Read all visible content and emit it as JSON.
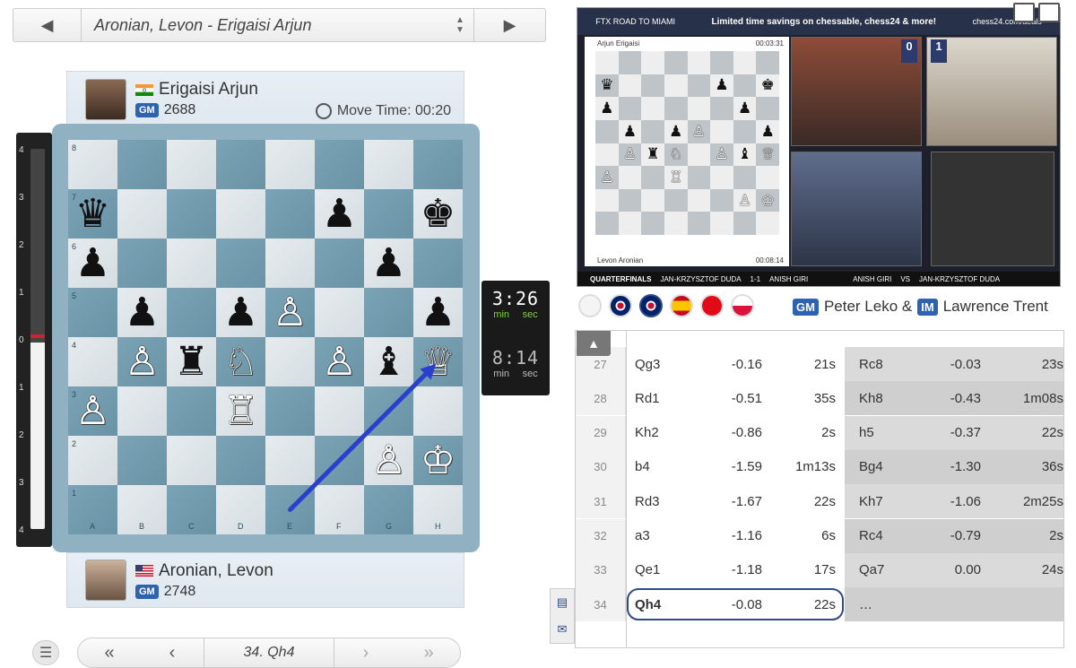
{
  "game_selector": {
    "title": "Aronian, Levon - Erigaisi Arjun",
    "prev_icon": "triangle-left",
    "next_icon": "triangle-right"
  },
  "top_player": {
    "name": "Erigaisi Arjun",
    "title": "GM",
    "rating": "2688",
    "flag": "india",
    "move_time_label": "Move Time: 00:20"
  },
  "bottom_player": {
    "name": "Aronian, Levon",
    "title": "GM",
    "rating": "2748",
    "flag": "usa"
  },
  "eval_bar": {
    "labels": [
      "4",
      "3",
      "2",
      "1",
      "0",
      "1",
      "2",
      "3",
      "4"
    ],
    "white_fraction": 0.49
  },
  "clocks": {
    "top": {
      "time": "3:26",
      "min": "min",
      "sec": "sec"
    },
    "bottom": {
      "time": "8:14",
      "min": "min",
      "sec": "sec"
    }
  },
  "board": {
    "files": [
      "A",
      "B",
      "C",
      "D",
      "E",
      "F",
      "G",
      "H"
    ],
    "ranks": [
      "8",
      "7",
      "6",
      "5",
      "4",
      "3",
      "2",
      "1"
    ],
    "position": [
      [
        "",
        "",
        "",
        "",
        "",
        "",
        "",
        ""
      ],
      [
        "bQ",
        "",
        "",
        "",
        "",
        "bP",
        "",
        "bK"
      ],
      [
        "bP",
        "",
        "",
        "",
        "",
        "",
        "bP",
        ""
      ],
      [
        "",
        "bP",
        "",
        "bP",
        "wP",
        "",
        "",
        "bP"
      ],
      [
        "",
        "wP",
        "bR",
        "wN",
        "",
        "wP",
        "bB",
        "wQ"
      ],
      [
        "wP",
        "",
        "",
        "wR",
        "",
        "",
        "",
        ""
      ],
      [
        "",
        "",
        "",
        "",
        "",
        "",
        "wP",
        "wK"
      ],
      [
        "",
        "",
        "",
        "",
        "",
        "",
        "",
        ""
      ]
    ],
    "arrow_from": "e1",
    "arrow_to": "h4",
    "arrow_color": "#2b3fcf"
  },
  "navigation": {
    "current_move": "34. Qh4"
  },
  "video": {
    "banner_left": "FTX ROAD TO MIAMI",
    "banner_deal": "Limited time savings on chessable, chess24 & more!",
    "banner_right": "chess24.com/deals",
    "mini_top_player": "Arjun Erigaisi",
    "mini_top_clock": "00:03:31",
    "mini_bottom_player": "Levon Aronian",
    "mini_bottom_clock": "00:08:14",
    "score_left": "0",
    "score_right": "1",
    "lower_third": [
      "QUARTERFINALS",
      "JAN-KRZYSZTOF DUDA",
      "1-1",
      "ANISH GIRI",
      "ANISH GIRI",
      "VS",
      "JAN-KRZYSZTOF DUDA"
    ]
  },
  "commentary": {
    "gm_badge": "GM",
    "im_badge": "IM",
    "names_a": "Peter Leko &",
    "names_b": "Lawrence Trent",
    "languages": [
      "computer",
      "english",
      "english",
      "spanish",
      "turkish",
      "polish"
    ]
  },
  "moves": [
    {
      "n": "27",
      "w": "Qg3",
      "we": "-0.16",
      "wt": "21s",
      "b": "Rc8",
      "be": "-0.03",
      "bt": "23s"
    },
    {
      "n": "28",
      "w": "Rd1",
      "we": "-0.51",
      "wt": "35s",
      "b": "Kh8",
      "be": "-0.43",
      "bt": "1m08s"
    },
    {
      "n": "29",
      "w": "Kh2",
      "we": "-0.86",
      "wt": "2s",
      "b": "h5",
      "be": "-0.37",
      "bt": "22s"
    },
    {
      "n": "30",
      "w": "b4",
      "we": "-1.59",
      "wt": "1m13s",
      "b": "Bg4",
      "be": "-1.30",
      "bt": "36s"
    },
    {
      "n": "31",
      "w": "Rd3",
      "we": "-1.67",
      "wt": "22s",
      "b": "Kh7",
      "be": "-1.06",
      "bt": "2m25s"
    },
    {
      "n": "32",
      "w": "a3",
      "we": "-1.16",
      "wt": "6s",
      "b": "Rc4",
      "be": "-0.79",
      "bt": "2s"
    },
    {
      "n": "33",
      "w": "Qe1",
      "we": "-1.18",
      "wt": "17s",
      "b": "Qa7",
      "be": "0.00",
      "bt": "24s"
    },
    {
      "n": "34",
      "w": "Qh4",
      "we": "-0.08",
      "wt": "22s",
      "b": "…",
      "be": "",
      "bt": ""
    }
  ]
}
